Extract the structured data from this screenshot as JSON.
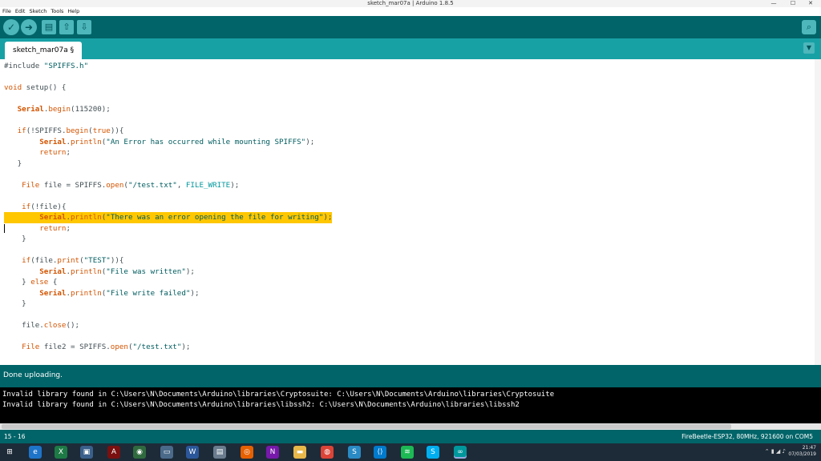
{
  "window": {
    "title": "sketch_mar07a | Arduino 1.8.5",
    "minimize": "—",
    "maximize": "☐",
    "close": "✕"
  },
  "menu": [
    "File",
    "Edit",
    "Sketch",
    "Tools",
    "Help"
  ],
  "toolbar": {
    "verify_icon": "check-icon",
    "verify_glyph": "✓",
    "upload_icon": "arrow-right-icon",
    "upload_glyph": "➜",
    "new_icon": "new-file-icon",
    "new_glyph": "▤",
    "open_icon": "open-arrow-up-icon",
    "open_glyph": "⇧",
    "save_icon": "save-arrow-down-icon",
    "save_glyph": "⇩",
    "serial_icon": "magnifier-icon",
    "serial_glyph": "⌕"
  },
  "tab": {
    "label": "sketch_mar07a §",
    "menu_glyph": "▼"
  },
  "code_lines": [
    "#include \"SPIFFS.h\"",
    "",
    "void setup() {",
    "",
    "   Serial.begin(115200);",
    "",
    "   if(!SPIFFS.begin(true)){",
    "        Serial.println(\"An Error has occurred while mounting SPIFFS\");",
    "        return;",
    "   }",
    "",
    "    File file = SPIFFS.open(\"/test.txt\", FILE_WRITE);",
    "",
    "    if(!file){",
    "        Serial.println(\"There was an error opening the file for writing\");",
    "        return;",
    "    }",
    "",
    "    if(file.print(\"TEST\")){",
    "        Serial.println(\"File was written\");",
    "    } else {",
    "        Serial.println(\"File write failed\");",
    "    }",
    "",
    "    file.close();",
    "",
    "    File file2 = SPIFFS.open(\"/test.txt\");"
  ],
  "highlighted_line": 14,
  "status": {
    "message": "Done uploading."
  },
  "console_lines": [
    "Invalid library found in C:\\Users\\N\\Documents\\Arduino\\libraries\\Cryptosuite: C:\\Users\\N\\Documents\\Arduino\\libraries\\Cryptosuite",
    "Invalid library found in C:\\Users\\N\\Documents\\Arduino\\libraries\\libssh2: C:\\Users\\N\\Documents\\Arduino\\libraries\\libssh2"
  ],
  "bottom": {
    "line_range": "15 - 16",
    "board": "FireBeetle-ESP32, 80MHz, 921600 on COM5"
  },
  "taskbar": {
    "apps": [
      {
        "name": "start-icon",
        "color": "#1d2b38",
        "glyph": "⊞"
      },
      {
        "name": "edge-icon",
        "color": "#1e74c9",
        "glyph": "e"
      },
      {
        "name": "excel-icon",
        "color": "#1d7a45",
        "glyph": "X"
      },
      {
        "name": "monitor-icon",
        "color": "#3a5f8a",
        "glyph": "▣"
      },
      {
        "name": "acrobat-icon",
        "color": "#7a1010",
        "glyph": "A"
      },
      {
        "name": "app-circle-icon",
        "color": "#2f6a3f",
        "glyph": "◉"
      },
      {
        "name": "window-icon",
        "color": "#4b6a8a",
        "glyph": "▭"
      },
      {
        "name": "word-icon",
        "color": "#2b579a",
        "glyph": "W"
      },
      {
        "name": "file-icon",
        "color": "#6a7c8e",
        "glyph": "▤"
      },
      {
        "name": "firefox-icon",
        "color": "#e66000",
        "glyph": "◎"
      },
      {
        "name": "onenote-icon",
        "color": "#7719aa",
        "glyph": "N"
      },
      {
        "name": "folder-icon",
        "color": "#e8b84a",
        "glyph": "▬"
      },
      {
        "name": "chrome-icon",
        "color": "#db4437",
        "glyph": "◍"
      },
      {
        "name": "app-s-icon",
        "color": "#2a8ac4",
        "glyph": "S"
      },
      {
        "name": "vscode-icon",
        "color": "#007acc",
        "glyph": "⟨⟩"
      },
      {
        "name": "spotify-icon",
        "color": "#1db954",
        "glyph": "≋"
      },
      {
        "name": "skype-icon",
        "color": "#00aff0",
        "glyph": "S"
      },
      {
        "name": "arduino-icon",
        "color": "#00979c",
        "glyph": "∞"
      }
    ],
    "tray_icons": "⌃ ▮ ◢ ♪",
    "time": "21:47",
    "date": "07/03/2019"
  },
  "colors": {
    "teal_dark": "#006468",
    "teal_tab": "#17a1a5",
    "highlight": "#ffc700"
  }
}
